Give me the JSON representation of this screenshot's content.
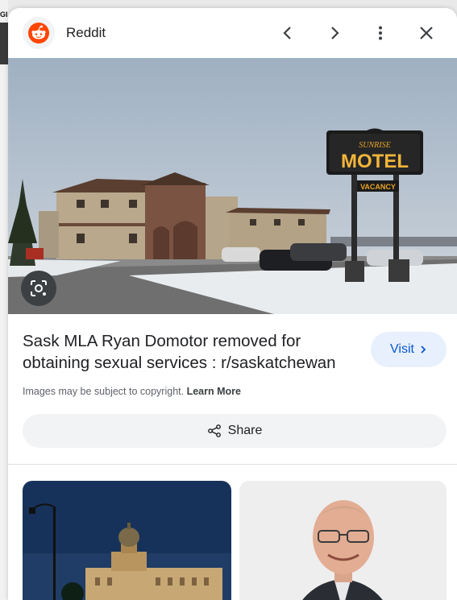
{
  "background": {
    "label": "GI"
  },
  "header": {
    "site_name": "Reddit",
    "back_icon": "chevron-left-icon",
    "forward_icon": "chevron-right-icon",
    "more_icon": "more-vertical-icon",
    "close_icon": "close-icon"
  },
  "hero": {
    "sign_top": "SUNRISE",
    "sign_main": "MOTEL",
    "sign_sub": "VACANCY",
    "lens_icon": "google-lens-icon"
  },
  "result": {
    "title": "Sask MLA Ryan Domotor removed for obtaining sexual services : r/saskatchewan",
    "visit_label": "Visit",
    "copyright_text": "Images may be subject to copyright.",
    "learn_more": "Learn More",
    "share_label": "Share"
  },
  "related": {
    "thumb1": "legislative-building-photo",
    "thumb2": "man-portrait-photo"
  },
  "colors": {
    "accent": "#0b57d0",
    "visit_bg": "#e8f0fe",
    "reddit": "#ff4500"
  }
}
